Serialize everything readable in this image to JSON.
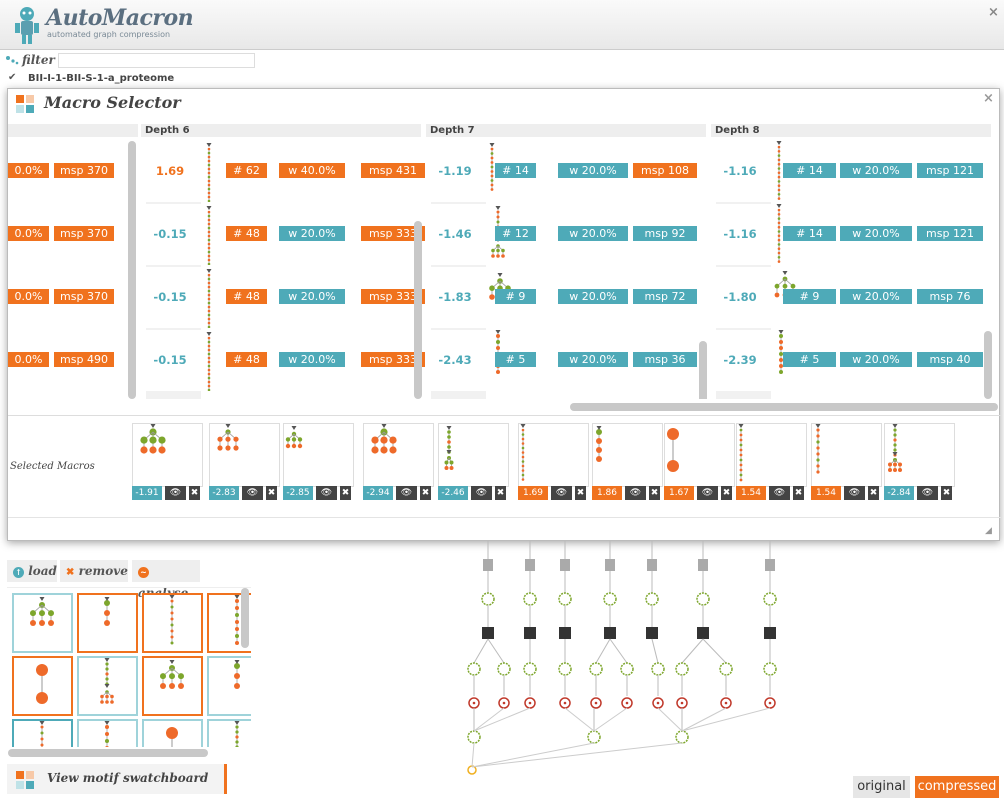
{
  "app": {
    "title": "AutoMacron",
    "subtitle": "automated graph compression",
    "close": "×"
  },
  "filter": {
    "label": "filter",
    "value": ""
  },
  "dataset": {
    "check": "✔",
    "name": "BII-I-1-BII-S-1-a_proteome"
  },
  "macro_selector": {
    "title": "Macro Selector",
    "close": "×",
    "resize": "◢",
    "depths": [
      {
        "label": "Depth 6"
      },
      {
        "label": "Depth 7"
      },
      {
        "label": "Depth 8"
      }
    ],
    "left_col": [
      {
        "w": "0.0%",
        "msp": "msp 370"
      },
      {
        "w": "0.0%",
        "msp": "msp 370"
      },
      {
        "w": "0.0%",
        "msp": "msp 370"
      },
      {
        "w": "0.0%",
        "msp": "msp 490"
      }
    ],
    "col6": [
      {
        "score": "1.69",
        "count": "# 62",
        "w": "w 40.0%",
        "msp": "msp 431",
        "c": "o"
      },
      {
        "score": "-0.15",
        "count": "# 48",
        "w": "w 20.0%",
        "msp": "msp 333",
        "c": "b"
      },
      {
        "score": "-0.15",
        "count": "# 48",
        "w": "w 20.0%",
        "msp": "msp 333",
        "c": "b"
      },
      {
        "score": "-0.15",
        "count": "# 48",
        "w": "w 20.0%",
        "msp": "msp 333",
        "c": "b"
      }
    ],
    "col7": [
      {
        "score": "-1.19",
        "count": "# 14",
        "w": "w 20.0%",
        "msp": "msp 108",
        "c": "b",
        "mspc": "o"
      },
      {
        "score": "-1.46",
        "count": "# 12",
        "w": "w 20.0%",
        "msp": "msp 92",
        "c": "b",
        "mspc": "b"
      },
      {
        "score": "-1.83",
        "count": "# 9",
        "w": "w 20.0%",
        "msp": "msp 72",
        "c": "b",
        "mspc": "b"
      },
      {
        "score": "-2.43",
        "count": "# 5",
        "w": "w 20.0%",
        "msp": "msp 36",
        "c": "b",
        "mspc": "b"
      }
    ],
    "col8": [
      {
        "score": "-1.16",
        "count": "# 14",
        "w": "w 20.0%",
        "msp": "msp 121",
        "c": "b"
      },
      {
        "score": "-1.16",
        "count": "# 14",
        "w": "w 20.0%",
        "msp": "msp 121",
        "c": "b"
      },
      {
        "score": "-1.80",
        "count": "# 9",
        "w": "w 20.0%",
        "msp": "msp 76",
        "c": "b"
      },
      {
        "score": "-2.39",
        "count": "# 5",
        "w": "w 20.0%",
        "msp": "msp 40",
        "c": "b"
      }
    ],
    "selected_label": "Selected Macros",
    "selected": [
      {
        "score": "-1.91",
        "c": "b"
      },
      {
        "score": "-2.83",
        "c": "b"
      },
      {
        "score": "-2.85",
        "c": "b"
      },
      {
        "score": "-2.94",
        "c": "b"
      },
      {
        "score": "-2.46",
        "c": "b"
      },
      {
        "score": "1.69",
        "c": "o"
      },
      {
        "score": "1.86",
        "c": "o"
      },
      {
        "score": "1.67",
        "c": "o"
      },
      {
        "score": "1.54",
        "c": "o"
      },
      {
        "score": "1.54",
        "c": "o"
      },
      {
        "score": "-2.84",
        "c": "b"
      }
    ],
    "eye_icon": "👁",
    "remove_icon": "✖"
  },
  "toolbar": {
    "load": "load",
    "remove": "remove",
    "analyse": "analyse"
  },
  "swatchboard": {
    "label": "View motif swatchboard"
  },
  "view_toggle": {
    "original": "original",
    "compressed": "compressed"
  },
  "colors": {
    "orange": "#f0721e",
    "teal": "#4eaab8",
    "green": "#7da62c",
    "node_orange": "#ee6a2a"
  }
}
